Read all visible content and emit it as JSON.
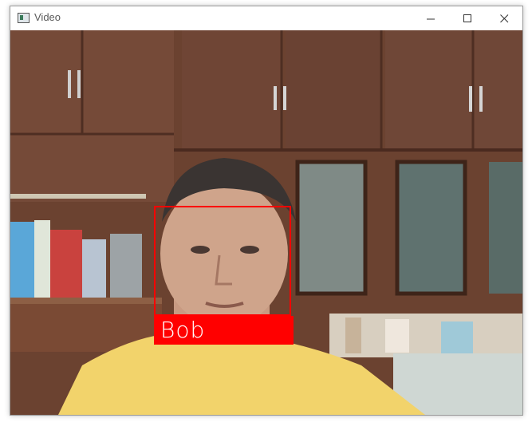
{
  "window": {
    "title": "Video",
    "app_icon": "video-window-icon",
    "controls": {
      "minimize_icon": "minimize-icon",
      "maximize_icon": "maximize-icon",
      "close_icon": "close-icon"
    }
  },
  "video": {
    "detection": {
      "label": "Bob",
      "box_color": "#ff0000",
      "label_text_color": "#ffffff"
    }
  }
}
